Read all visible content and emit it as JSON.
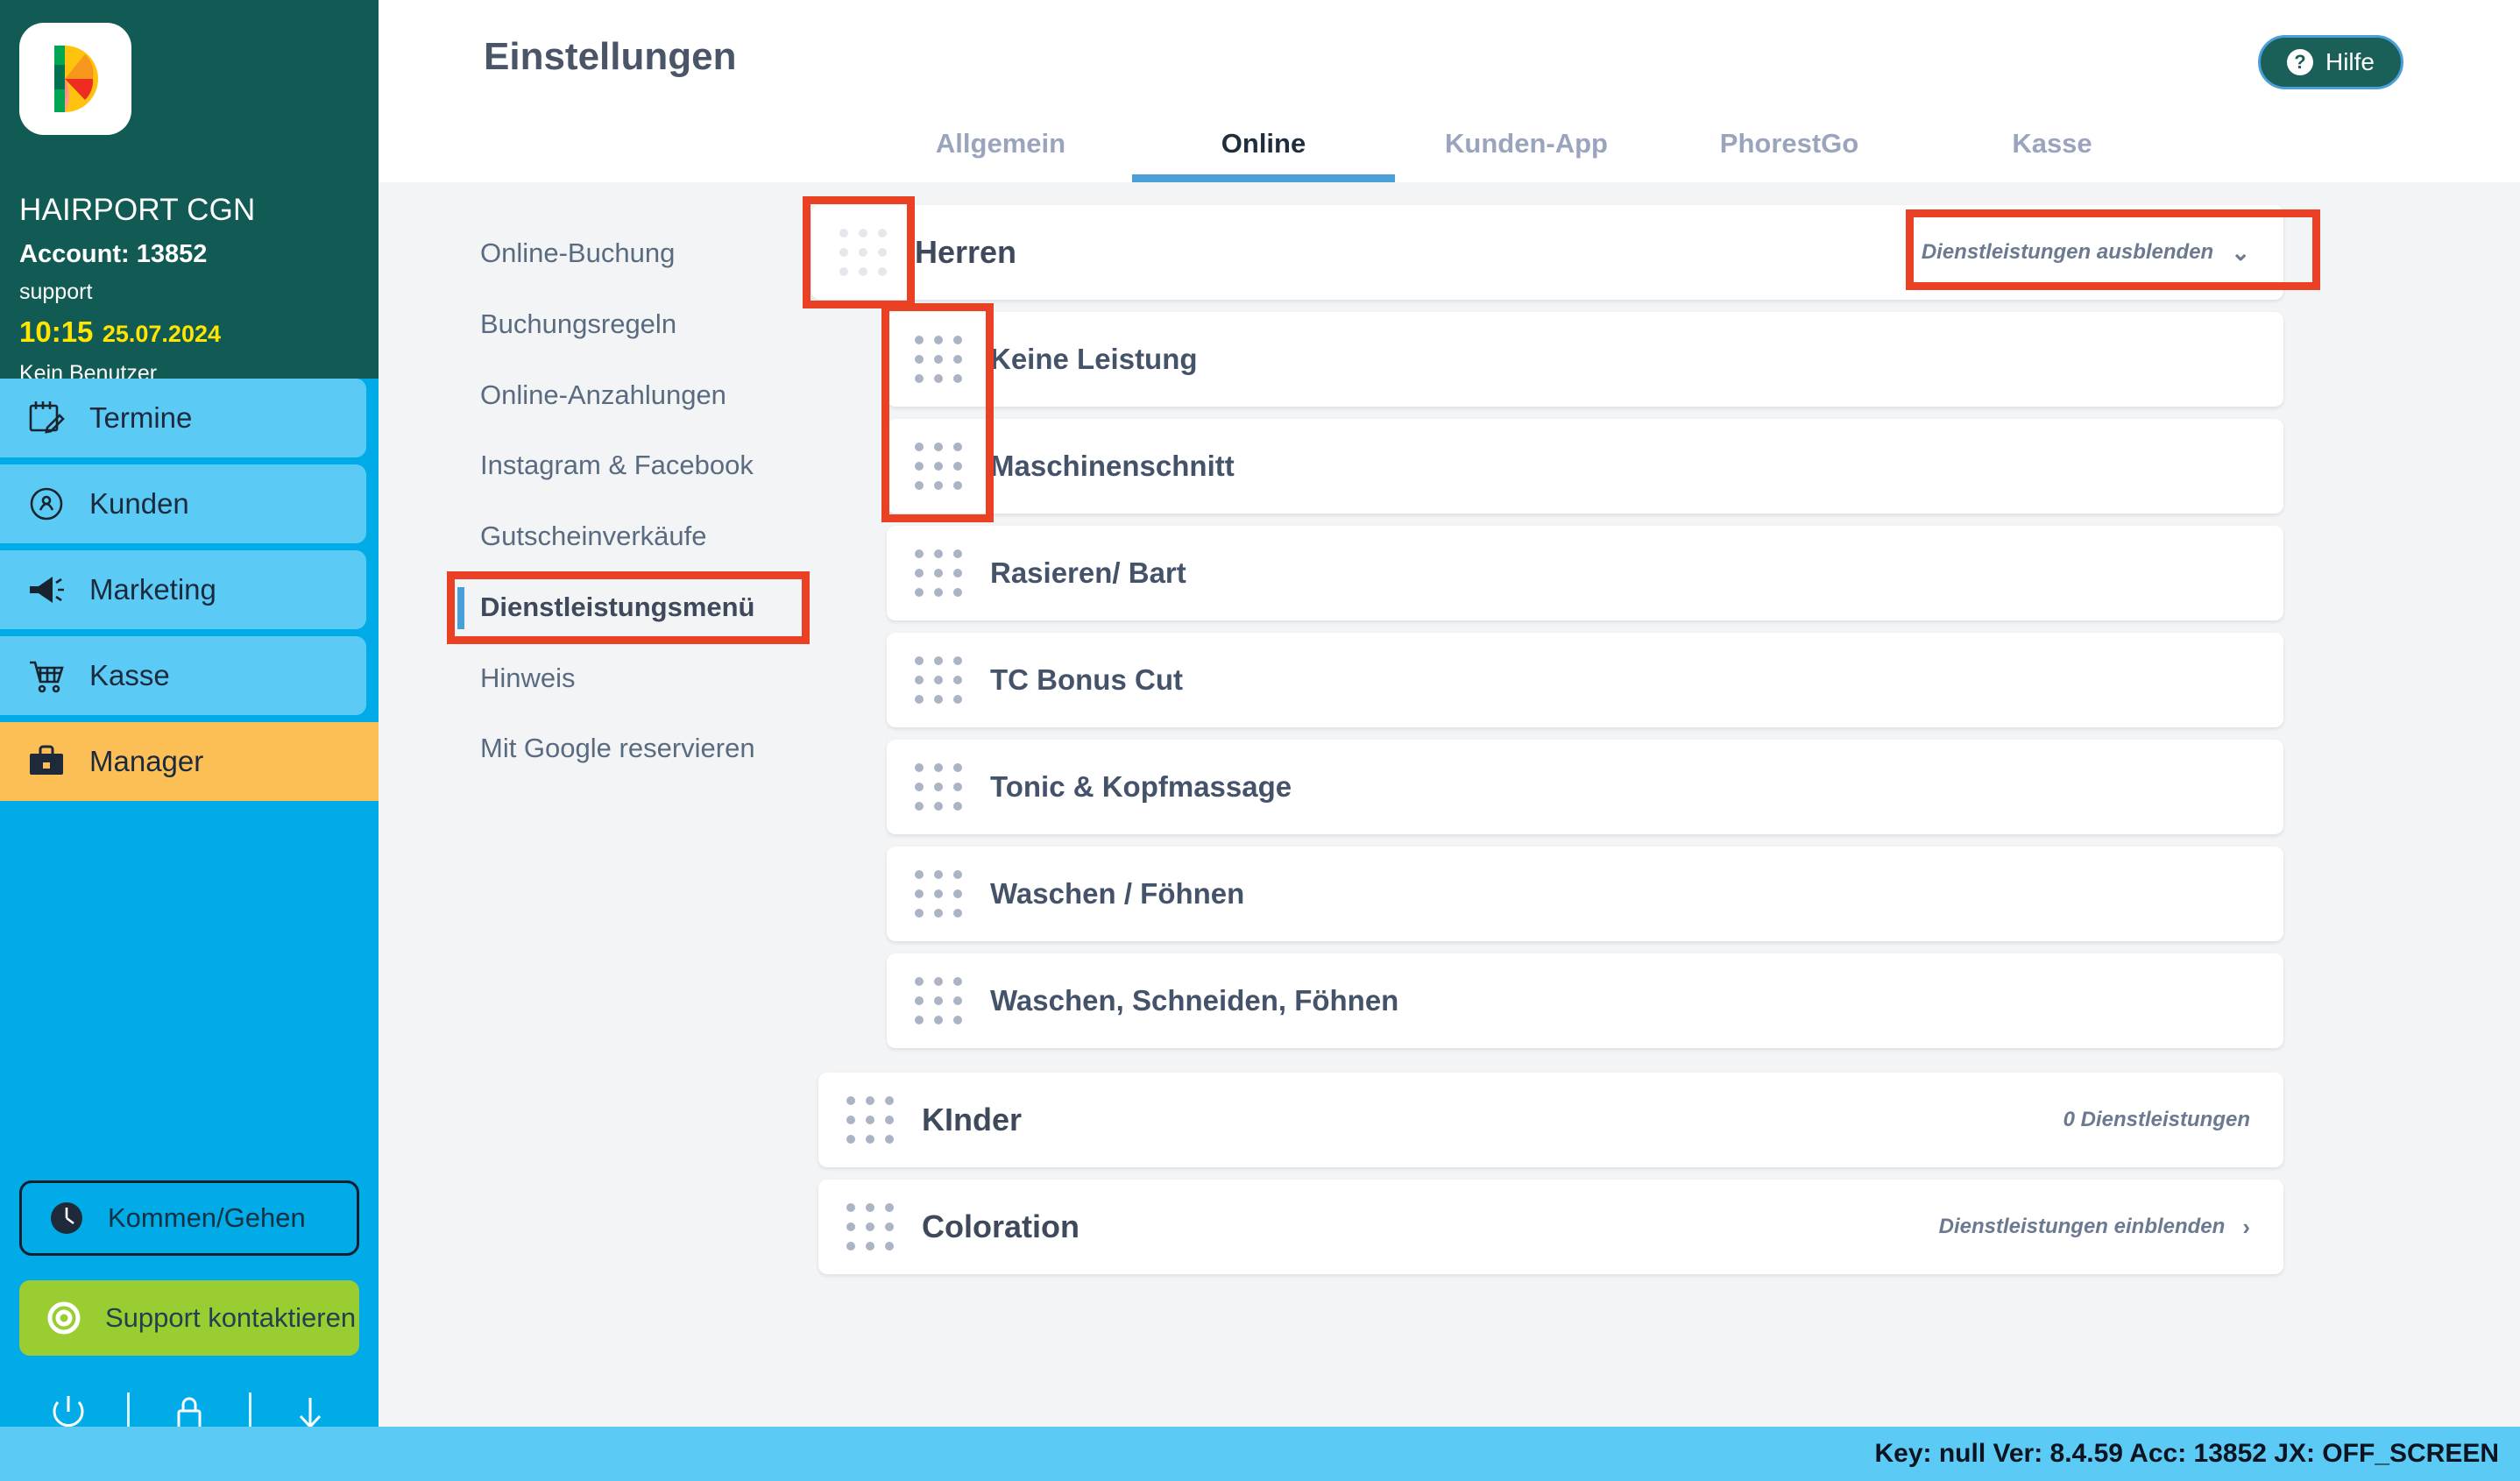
{
  "sidebar": {
    "salon_name": "HAIRPORT CGN",
    "account": "Account: 13852",
    "user_role": "support",
    "clock_time": "10:15",
    "clock_date": "25.07.2024",
    "no_user": "Kein Benutzer",
    "nav": [
      {
        "label": "Termine",
        "icon": "calendar-edit-icon",
        "active": false
      },
      {
        "label": "Kunden",
        "icon": "client-icon",
        "active": false
      },
      {
        "label": "Marketing",
        "icon": "megaphone-icon",
        "active": false
      },
      {
        "label": "Kasse",
        "icon": "shopping-cart-icon",
        "active": false
      },
      {
        "label": "Manager",
        "icon": "briefcase-icon",
        "active": true
      }
    ],
    "kommen_gehen": "Kommen/Gehen",
    "support_kontaktieren": "Support kontaktieren",
    "footer_icons": [
      "power-icon",
      "lock-icon",
      "download-arrow-icon"
    ]
  },
  "header": {
    "title": "Einstellungen",
    "help_label": "Hilfe",
    "tabs": [
      {
        "label": "Allgemein",
        "active": false
      },
      {
        "label": "Online",
        "active": true
      },
      {
        "label": "Kunden-App",
        "active": false
      },
      {
        "label": "PhorestGo",
        "active": false
      },
      {
        "label": "Kasse",
        "active": false
      }
    ]
  },
  "submenu": {
    "items": [
      {
        "label": "Online-Buchung",
        "active": false
      },
      {
        "label": "Buchungsregeln",
        "active": false
      },
      {
        "label": "Online-Anzahlungen",
        "active": false
      },
      {
        "label": "Instagram & Facebook",
        "active": false
      },
      {
        "label": "Gutscheinverkäufe",
        "active": false
      },
      {
        "label": "Dienstleistungsmenü",
        "active": true
      },
      {
        "label": "Hinweis",
        "active": false
      },
      {
        "label": "Mit Google reservieren",
        "active": false
      }
    ]
  },
  "categories": [
    {
      "name": "Herren",
      "toggle_label": "Dienstleistungen ausblenden",
      "toggle_icon": "chevron-down-icon",
      "services": [
        "Keine Leistung",
        "Maschinenschnitt",
        "Rasieren/ Bart",
        "TC Bonus Cut",
        "Tonic & Kopfmassage",
        "Waschen / Föhnen",
        "Waschen, Schneiden, Föhnen"
      ]
    },
    {
      "name": "KInder",
      "toggle_label": "0 Dienstleistungen",
      "toggle_icon": "",
      "services": []
    },
    {
      "name": "Coloration",
      "toggle_label": "Dienstleistungen einblenden",
      "toggle_icon": "chevron-right-icon",
      "services": []
    }
  ],
  "statusbar": {
    "text": "Key: null Ver: 8.4.59 Acc: 13852  JX: OFF_SCREEN"
  },
  "colors": {
    "teal": "#115B54",
    "blue": "#00ABE8",
    "light_blue": "#5BCBF5",
    "amber": "#FBBF56",
    "green": "#9ACD32",
    "annotation_red": "#EA4024",
    "accent": "#4a9fd8"
  }
}
